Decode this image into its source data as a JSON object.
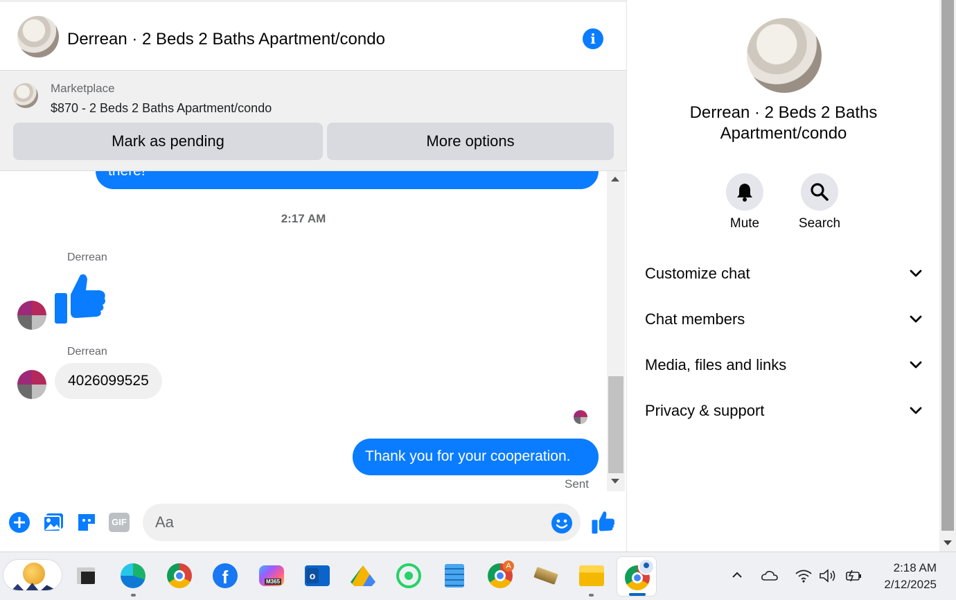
{
  "header": {
    "title": "Derrean · 2 Beds 2 Baths Apartment/condo"
  },
  "marketplace": {
    "label": "Marketplace",
    "listing": "$870 - 2 Beds 2 Baths Apartment/condo",
    "mark_pending": "Mark as pending",
    "more_options": "More options"
  },
  "messages": {
    "partial_bubble": "there!",
    "timestamp": "2:17 AM",
    "sender1": "Derrean",
    "sender2": "Derrean",
    "phone": "4026099525",
    "outgoing": "Thank you for your cooperation.",
    "status": "Sent"
  },
  "composer": {
    "placeholder": "Aa",
    "gif_label": "GIF"
  },
  "right_panel": {
    "title": "Derrean · 2 Beds 2 Baths Apartment/condo",
    "mute_label": "Mute",
    "search_label": "Search",
    "sections": [
      "Customize chat",
      "Chat members",
      "Media, files and links",
      "Privacy & support"
    ]
  },
  "taskbar": {
    "time": "2:18 AM",
    "date": "2/12/2025",
    "m365_label": "M365",
    "chrome_badge": "A"
  },
  "colors": {
    "messenger_blue": "#0a7cff",
    "bubble_grey": "#f0f0f0"
  }
}
